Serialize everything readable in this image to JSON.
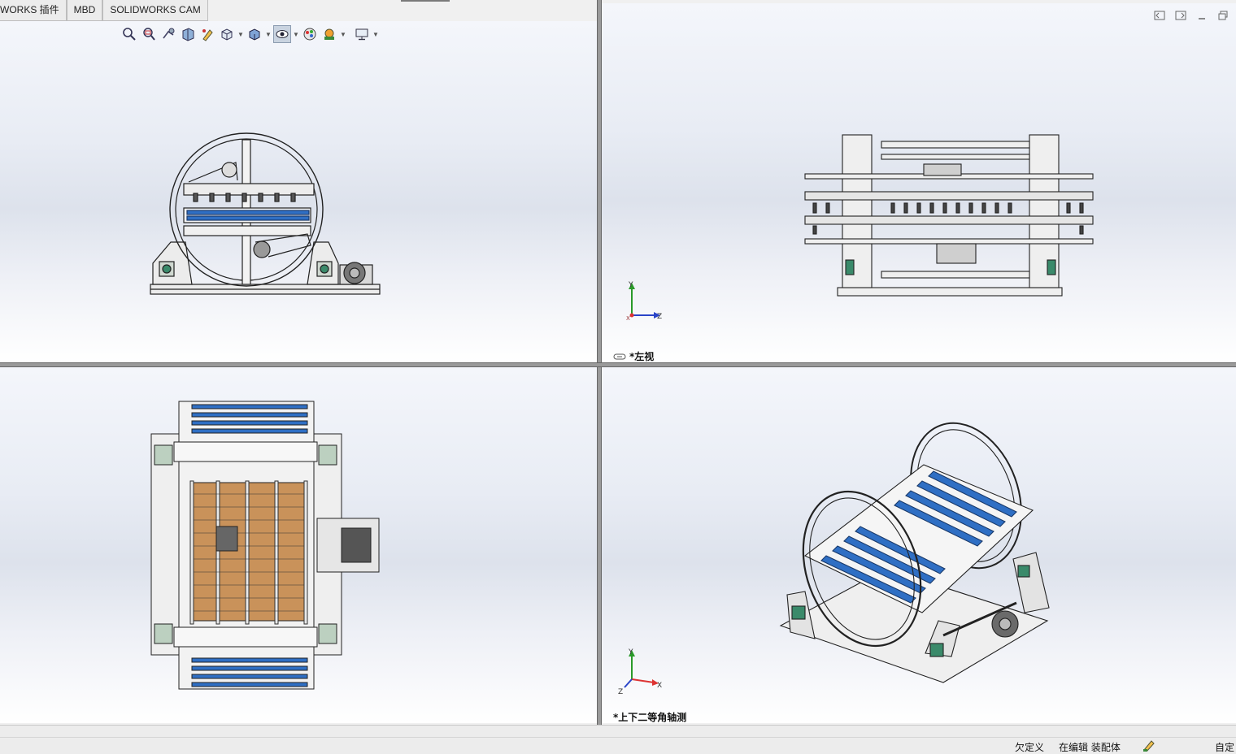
{
  "tabs": [
    {
      "label": "WORKS 插件"
    },
    {
      "label": "MBD"
    },
    {
      "label": "SOLIDWORKS CAM"
    }
  ],
  "hud_toolbar": {
    "icons": [
      "zoom-to-fit-icon",
      "zoom-area-icon",
      "previous-view-icon",
      "section-view-icon",
      "dynamic-annotation-icon",
      "view-orientation-icon",
      "display-style-icon",
      "hide-show-items-icon",
      "edit-appearance-icon",
      "apply-scene-icon",
      "view-settings-icon"
    ]
  },
  "window_controls": [
    "tile-left-icon",
    "tile-right-icon",
    "minimize-icon",
    "restore-icon"
  ],
  "viewports": {
    "top_left": {
      "label": ""
    },
    "top_right": {
      "label": "*左视",
      "axes": {
        "y": "Y",
        "z": "Z",
        "x": "X"
      }
    },
    "bottom_left": {
      "label": ""
    },
    "bottom_right": {
      "label": "*上下二等角轴测",
      "axes": {
        "y": "Y",
        "z": "Z",
        "x": "X"
      }
    }
  },
  "status_bar": {
    "state": "欠定义",
    "mode": "在编辑 装配体",
    "custom": "自定"
  },
  "colors": {
    "roller_blue": "#2f6fc4",
    "frame": "#e8e8e8",
    "outline": "#222222",
    "plank": "#c9925a"
  }
}
